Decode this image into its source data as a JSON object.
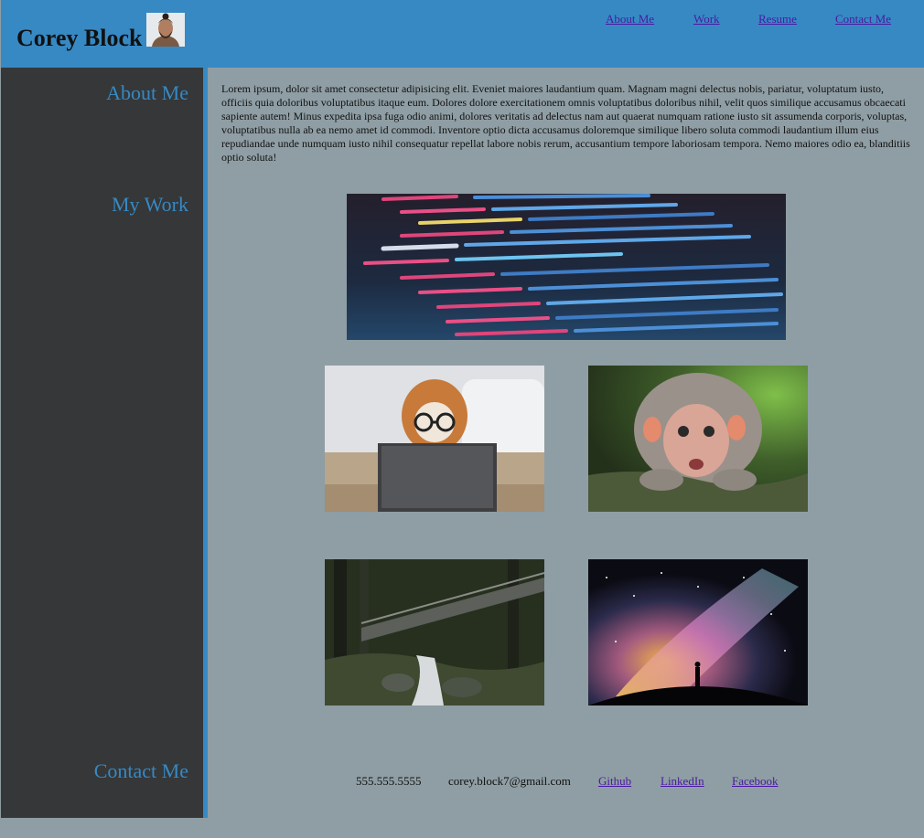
{
  "header": {
    "title": "Corey Block",
    "nav": [
      "About Me",
      "Work",
      "Resume",
      "Contact Me"
    ]
  },
  "sidebar": {
    "items": [
      "About Me",
      "My Work",
      "Contact Me"
    ]
  },
  "main": {
    "intro": "Lorem ipsum, dolor sit amet consectetur adipisicing elit. Eveniet maiores laudantium quam. Magnam magni delectus nobis, pariatur, voluptatum iusto, officiis quia doloribus voluptatibus itaque eum. Dolores dolore exercitationem omnis voluptatibus doloribus nihil, velit quos similique accusamus obcaecati sapiente autem! Minus expedita ipsa fuga odio animi, dolores veritatis ad delectus nam aut quaerat numquam ratione iusto sit assumenda corporis, voluptas, voluptatibus nulla ab ea nemo amet id commodi. Inventore optio dicta accusamus doloremque similique libero soluta commodi laudantium illum eius repudiandae unde numquam iusto nihil consequatur repellat labore nobis rerum, accusantium tempore laboriosam tempora. Nemo maiores odio ea, blanditiis optio soluta!"
  },
  "footer": {
    "phone": "555.555.5555",
    "email": "corey.block7@gmail.com",
    "links": [
      "Github",
      "LinkedIn",
      "Facebook"
    ]
  },
  "colors": {
    "header_bg": "#3789c4",
    "sidebar_bg": "#353738",
    "page_bg": "#8f9ea4",
    "link_visited": "#4a1aa3"
  }
}
